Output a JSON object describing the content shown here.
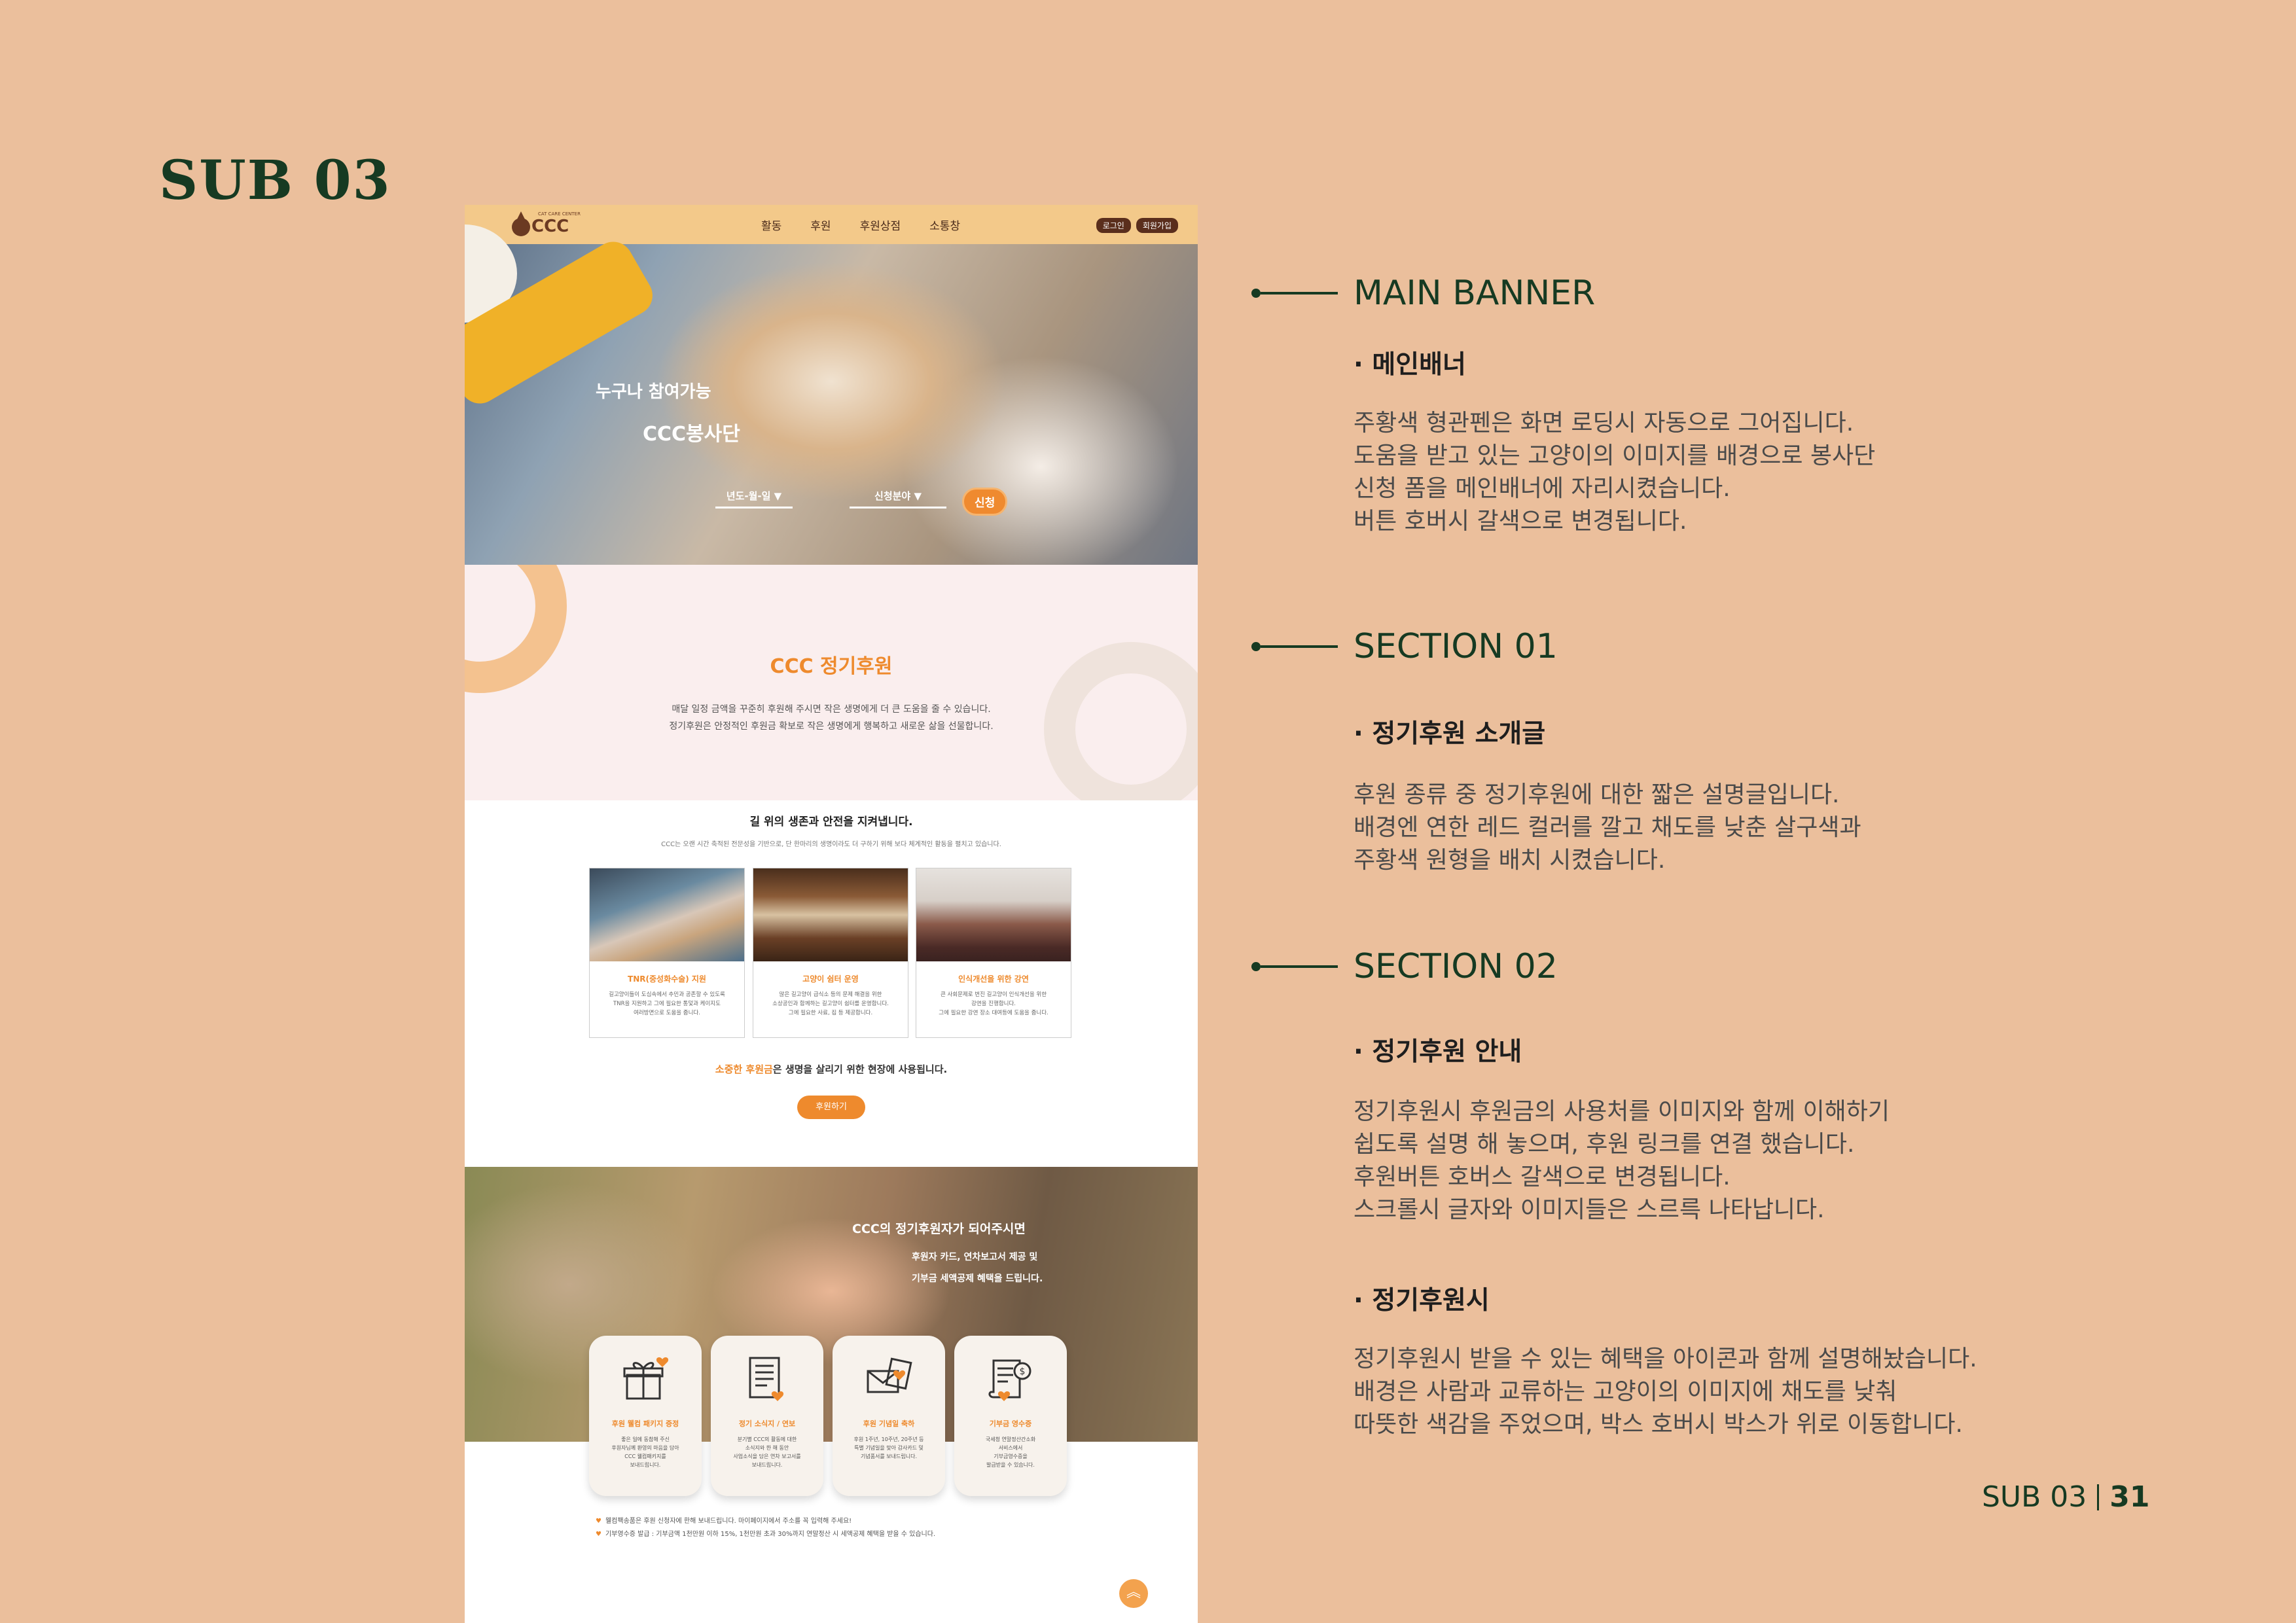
{
  "page": {
    "heading": "SUB 03",
    "page_label": "SUB 03",
    "page_number": "31"
  },
  "mockup": {
    "logo": {
      "small": "CAT CARE CENTER",
      "text": "CCC"
    },
    "nav": [
      "활동",
      "후원",
      "후원상점",
      "소통창"
    ],
    "auth": {
      "login": "로그인",
      "signup": "회원가입"
    },
    "banner": {
      "title1": "누구나 참여가능",
      "title2": "CCC봉사단",
      "select_date": "년도-월-일 ▼",
      "select_field": "신청분야 ▼",
      "apply": "신청"
    },
    "section1": {
      "title": "CCC 정기후원",
      "lines": [
        "매달 일정 금액을 꾸준히 후원해 주시면 작은 생명에게 더 큰 도움을 줄 수 있습니다.",
        "정기후원은 안정적인 후원금 확보로 작은 생명에게 행복하고 새로운 삶을 선물합니다."
      ]
    },
    "section2": {
      "title": "길 위의 생존과 안전을 지켜냅니다.",
      "subtitle": "CCC는 오랜 시간 축적된 전문성을 기반으로, 단 한마리의 생명이라도 더 구하기 위해 보다 체계적인 활동을 펼치고 있습니다.",
      "cards": [
        {
          "title": "TNR(중성화수술) 지원",
          "desc": [
            "길고양이들이 도심속에서 추민과 공존할 수 있도록",
            "TNR을 지원하고 그에 필요한 통덫과 케이지도",
            "여러방면으로 도움을 줍니다."
          ]
        },
        {
          "title": "고양이 쉼터 운영",
          "desc": [
            "많은 길고양이 급식소 등의 문제 해결을 위한",
            "소상공인과 함께하는 길고양이 쉼터를 운영합니다.",
            "그에 필요한 사료, 집 등 제공합니다."
          ]
        },
        {
          "title": "인식개선을 위한 강연",
          "desc": [
            "큰 사회문제로 번진 길고양이 인식개선을 위한",
            "강연을 진행합니다.",
            "그에 필요한 강연 장소 대여등에 도움을 줍니다."
          ]
        }
      ],
      "line_highlight": "소중한 후원금",
      "line_rest": "은 생명을 살리기 위한 현장에 사용됩니다.",
      "button": "후원하기"
    },
    "section3": {
      "t1": "CCC의 정기후원자가 되어주시면",
      "t2": "후원자 카드, 연차보고서 제공 및",
      "t3": "기부금 세액공제 혜택을 드립니다.",
      "cards": [
        {
          "icon": "gift-box-icon",
          "title": "후원 웰컴 패키지 증정",
          "desc": [
            "좋은 일에 동참해 주신",
            "후원자님께 환영의 마음을 담아",
            "CCC 웰컴패키지를",
            "보내드립니다."
          ]
        },
        {
          "icon": "document-icon",
          "title": "정기 소식지 / 연보",
          "desc": [
            "분기별 CCC의 활동에 대한",
            "소식지와 한 해 동안",
            "사업소식을 담은 연차 보고서를",
            "보내드립니다."
          ]
        },
        {
          "icon": "envelope-heart-icon",
          "title": "후원 기념일 축하",
          "desc": [
            "후원 1주년, 10주년, 20주년 등",
            "특별 기념일을 맞아 감사카드 및",
            "기념품서를 보내드립니다."
          ]
        },
        {
          "icon": "receipt-coin-icon",
          "title": "기부금 영수증",
          "desc": [
            "국세청 연말정산간소화",
            "서비스에서",
            "기부금영수증을",
            "발급받을 수 있습니다."
          ]
        }
      ],
      "notes": [
        "웰컴팩송품은 후원 신청자에 한해 보내드립니다. 마이페이지에서 주소를 꼭 입력해 주세요!",
        "기부영수증 발급 : 기부금액 1천만원 이하 15%, 1천만원 초과 30%까지 연말정산 시 세액공제 혜택을 받을 수 있습니다."
      ],
      "top_button": "︽"
    }
  },
  "descriptions": [
    {
      "heading": "MAIN BANNER",
      "blocks": [
        {
          "subhead": "· 메인배너",
          "lines": [
            "주황색 형관펜은 화면 로딩시 자동으로 그어집니다.",
            "도움을 받고 있는 고양이의 이미지를 배경으로 봉사단",
            "신청 폼을 메인배너에 자리시켰습니다.",
            "버튼 호버시 갈색으로 변경됩니다."
          ]
        }
      ]
    },
    {
      "heading": "SECTION 01",
      "blocks": [
        {
          "subhead": "· 정기후원 소개글",
          "lines": [
            "후원 종류 중 정기후원에 대한 짧은 설명글입니다.",
            "배경엔 연한 레드 컬러를 깔고 채도를 낮춘 살구색과",
            "주황색 원형을 배치 시켰습니다."
          ]
        }
      ]
    },
    {
      "heading": "SECTION 02",
      "blocks": [
        {
          "subhead": "· 정기후원 안내",
          "lines": [
            "정기후원시 후원금의 사용처를 이미지와 함께 이해하기",
            "쉽도록 설명 해 놓으며, 후원 링크를 연결 했습니다.",
            "후원버튼 호버스 갈색으로 변경됩니다.",
            "스크롤시 글자와 이미지들은 스르륵 나타납니다."
          ]
        },
        {
          "subhead": "· 정기후원시",
          "lines": [
            "정기후원시 받을 수 있는 혜택을 아이콘과 함께 설명해놨습니다.",
            "배경은 사람과 교류하는 고양이의 이미지에 채도를 낮춰",
            "따뜻한 색감을 주었으며, 박스 호버시 박스가 위로 이동합니다."
          ]
        }
      ]
    }
  ],
  "colors": {
    "background": "#ebbf9c",
    "accent": "#163a22",
    "orange": "#ee8a2d"
  }
}
